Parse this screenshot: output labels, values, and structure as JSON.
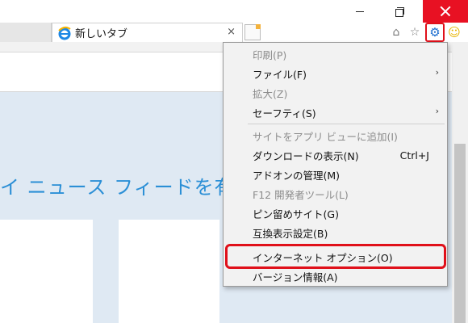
{
  "window": {
    "minimize_icon": "minimize-icon",
    "restore_icon": "restore-icon",
    "close_icon": "close-icon",
    "close_color": "#e81123"
  },
  "tab": {
    "title": "新しいタブ",
    "close_glyph": "×",
    "icon": "ie-logo-icon"
  },
  "toolbar": {
    "home_glyph": "⌂",
    "favorites_glyph": "☆",
    "tools_glyph": "⚙",
    "feedback_glyph": "☺",
    "tools_highlight_color": "#e0101a"
  },
  "page": {
    "heading": "イ ニュース フィードを有効にす",
    "heading_color": "#2b8fd6",
    "background_color": "#dfe9f3"
  },
  "menu": {
    "items": [
      {
        "label": "印刷(P)",
        "disabled": true,
        "submenu": false
      },
      {
        "label": "ファイル(F)",
        "disabled": false,
        "submenu": true
      },
      {
        "label": "拡大(Z)",
        "disabled": true,
        "submenu": false
      },
      {
        "label": "セーフティ(S)",
        "disabled": false,
        "submenu": true
      },
      {
        "label": "サイトをアプリ ビューに追加(I)",
        "disabled": true,
        "submenu": false
      },
      {
        "label": "ダウンロードの表示(N)",
        "disabled": false,
        "submenu": false,
        "shortcut": "Ctrl+J"
      },
      {
        "label": "アドオンの管理(M)",
        "disabled": false,
        "submenu": false
      },
      {
        "label": "F12 開発者ツール(L)",
        "disabled": true,
        "submenu": false
      },
      {
        "label": "ピン留めサイト(G)",
        "disabled": false,
        "submenu": false
      },
      {
        "label": "互換表示設定(B)",
        "disabled": false,
        "submenu": false
      },
      {
        "label": "インターネット オプション(O)",
        "disabled": false,
        "submenu": false,
        "highlighted": true
      },
      {
        "label": "バージョン情報(A)",
        "disabled": false,
        "submenu": false
      }
    ],
    "arrow_glyph": "›",
    "highlight_color": "#e0101a"
  }
}
